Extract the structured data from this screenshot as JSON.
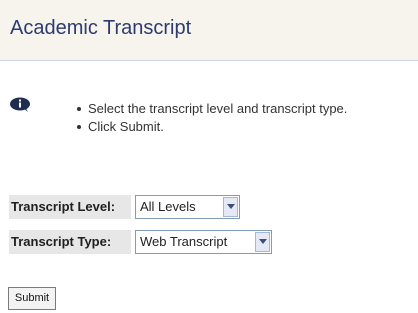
{
  "page": {
    "title": "Academic Transcript"
  },
  "instructions": {
    "icon": "info-icon",
    "items": [
      "Select the transcript level and transcript type.",
      "Click Submit."
    ]
  },
  "form": {
    "level": {
      "label": "Transcript Level:",
      "selected": "All Levels"
    },
    "type": {
      "label": "Transcript Type:",
      "selected": "Web Transcript"
    },
    "submit_label": "Submit"
  },
  "colors": {
    "title_text": "#2e3b6f",
    "title_bg": "#f6f4ec",
    "label_bg": "#e7e7e7"
  }
}
